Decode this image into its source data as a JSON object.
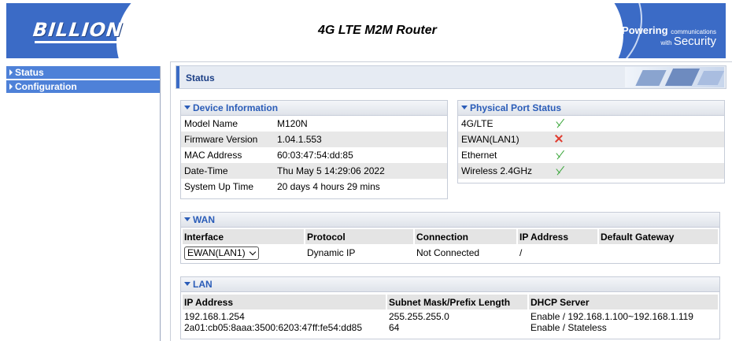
{
  "header": {
    "logo_text": "BILLION",
    "router_title": "4G LTE M2M Router",
    "tagline_powering": "Powering",
    "tagline_communications": "communications",
    "tagline_with": "with",
    "tagline_security": "Security"
  },
  "sidebar": {
    "items": [
      {
        "label": "Status"
      },
      {
        "label": "Configuration"
      }
    ]
  },
  "page": {
    "title": "Status"
  },
  "device_info": {
    "heading": "Device Information",
    "rows": [
      {
        "label": "Model Name",
        "value": "M120N"
      },
      {
        "label": "Firmware Version",
        "value": "1.04.1.553"
      },
      {
        "label": "MAC Address",
        "value": "60:03:47:54:dd:85"
      },
      {
        "label": "Date-Time",
        "value": "Thu May 5 14:29:06 2022"
      },
      {
        "label": "System Up Time",
        "value": "20 days 4 hours 29 mins"
      }
    ]
  },
  "port_status": {
    "heading": "Physical Port Status",
    "rows": [
      {
        "label": "4G/LTE",
        "icon": "check-icon",
        "status": "up"
      },
      {
        "label": "EWAN(LAN1)",
        "icon": "cross-icon",
        "status": "down"
      },
      {
        "label": "Ethernet",
        "icon": "check-icon",
        "status": "up"
      },
      {
        "label": "Wireless 2.4GHz",
        "icon": "check-icon",
        "status": "up"
      }
    ]
  },
  "wan": {
    "heading": "WAN",
    "columns": [
      "Interface",
      "Protocol",
      "Connection",
      "IP Address",
      "Default Gateway"
    ],
    "row": {
      "interface": "EWAN(LAN1)",
      "protocol": "Dynamic IP",
      "connection": "Not Connected",
      "ip_address": "/",
      "default_gateway": ""
    }
  },
  "lan": {
    "heading": "LAN",
    "columns": [
      "IP Address",
      "Subnet Mask/Prefix Length",
      "DHCP Server"
    ],
    "ip_line1": "192.168.1.254",
    "ip_line2": "2a01:cb05:8aaa:3500:6203:47ff:fe54:dd85",
    "mask_line1": "255.255.255.0",
    "mask_line2": "64",
    "dhcp_line1": "Enable / 192.168.1.100~192.168.1.119",
    "dhcp_line2": "Enable / Stateless"
  },
  "colors": {
    "brand_blue": "#3b6bc6",
    "nav_blue": "#4e81d8",
    "heading_blue": "#2a5cb8",
    "ok_green": "#3aa63a",
    "fail_red": "#e03b2f"
  }
}
